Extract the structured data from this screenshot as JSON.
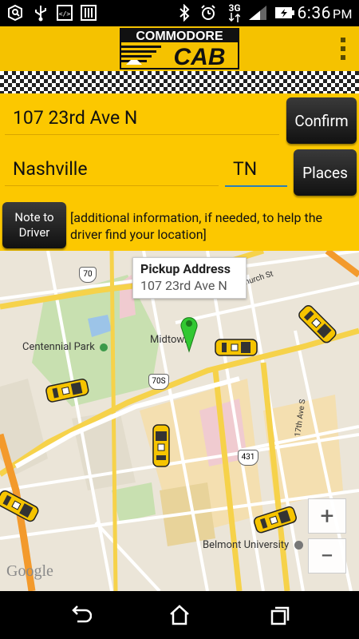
{
  "status_bar": {
    "time": "6:36",
    "ampm": "PM",
    "network": "3G"
  },
  "app": {
    "logo_top": "COMMODORE",
    "logo_bottom": "CAB"
  },
  "form": {
    "street_value": "107 23rd Ave N",
    "city_value": "Nashville",
    "state_value": "TN",
    "confirm_label": "Confirm",
    "places_label": "Places",
    "note_button_label_1": "Note to",
    "note_button_label_2": "Driver",
    "note_placeholder": "[additional information, if needed, to help the driver find your location]"
  },
  "map": {
    "callout_title": "Pickup Address",
    "callout_subtitle": "107 23rd Ave N",
    "labels": {
      "park": "Centennial Park",
      "midtown": "Midtown",
      "university": "Belmont University",
      "street": "17th Ave S",
      "street2": "Church St"
    },
    "shields": {
      "route_70": "70",
      "route_70s": "70S",
      "route_431": "431"
    },
    "zoom_in": "+",
    "zoom_out": "−",
    "attribution": "Google"
  }
}
